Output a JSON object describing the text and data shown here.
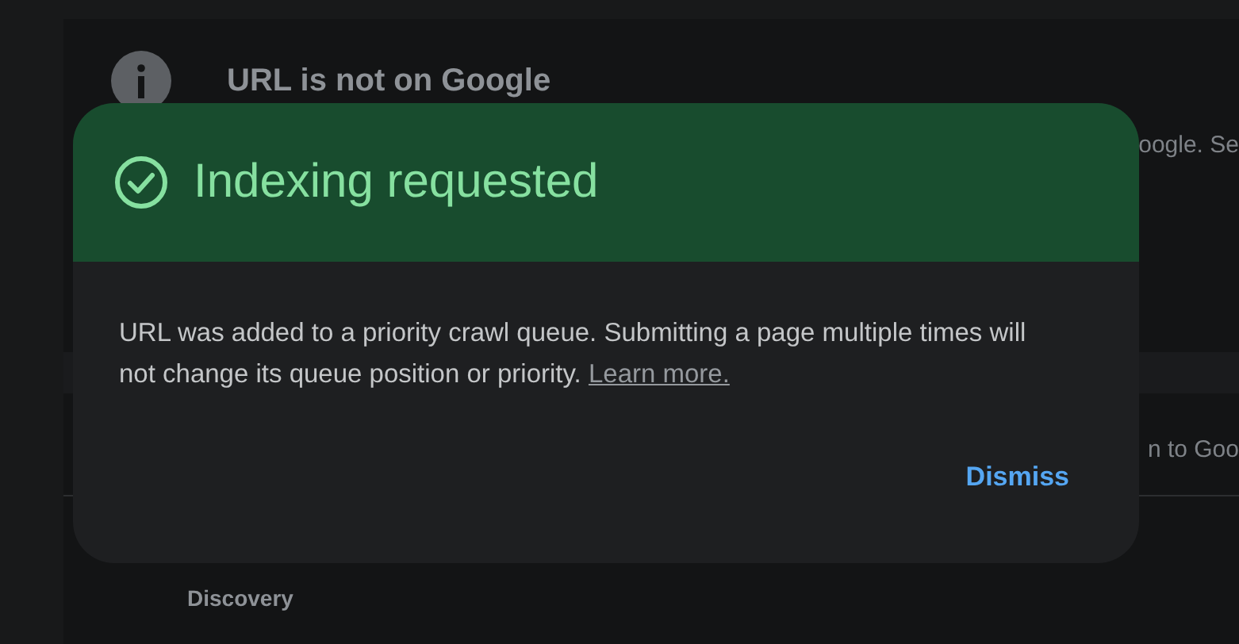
{
  "background": {
    "title": "URL is not on Google",
    "fragment_1": "oogle. Se",
    "fragment_2": "n to Goo",
    "section_label": "Discovery"
  },
  "dialog": {
    "title": "Indexing requested",
    "message": "URL was added to a priority crawl queue. Submitting a page multiple times will not change its queue position or priority.",
    "link": "Learn more.",
    "button": "Dismiss"
  }
}
